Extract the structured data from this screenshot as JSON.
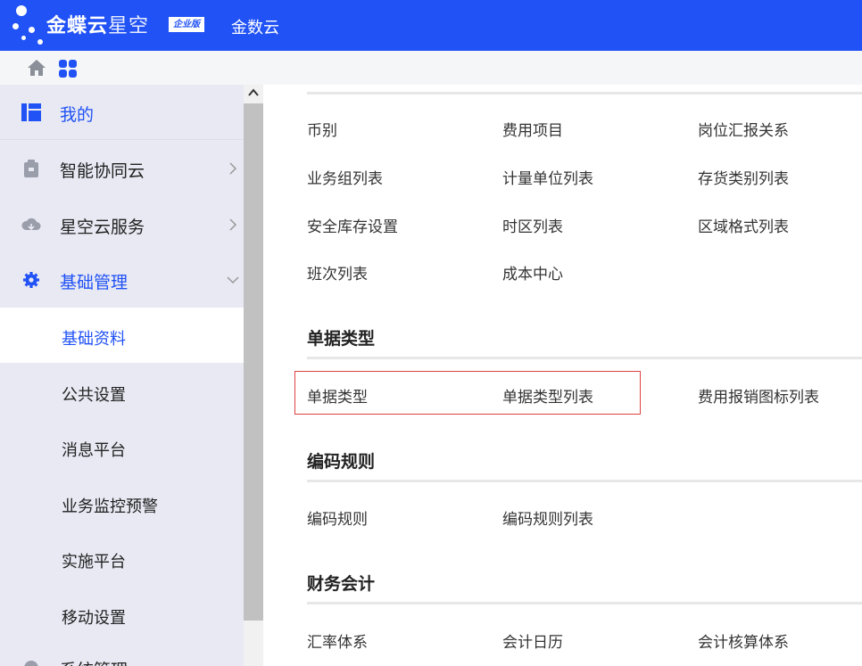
{
  "header": {
    "brand_main": "金蝶云",
    "brand_sub": "星空",
    "edition": "企业版",
    "cloud_name": "金数云"
  },
  "sidebar": {
    "groups": [
      {
        "label": "我的",
        "icon": "dashboard-icon"
      },
      {
        "label": "智能协同云",
        "icon": "clipboard-icon"
      },
      {
        "label": "星空云服务",
        "icon": "cloud-icon"
      },
      {
        "label": "基础管理",
        "icon": "gear-icon"
      }
    ],
    "subitems": [
      {
        "label": "基础资料",
        "active": true
      },
      {
        "label": "公共设置"
      },
      {
        "label": "消息平台"
      },
      {
        "label": "业务监控预警"
      },
      {
        "label": "实施平台"
      },
      {
        "label": "移动设置"
      },
      {
        "label": "系统管理"
      }
    ]
  },
  "content": {
    "top_items": [
      [
        "币别",
        "费用项目",
        "岗位汇报关系"
      ],
      [
        "业务组列表",
        "计量单位列表",
        "存货类别列表"
      ],
      [
        "安全库存设置",
        "时区列表",
        "区域格式列表"
      ],
      [
        "班次列表",
        "成本中心"
      ]
    ],
    "sections": [
      {
        "title": "单据类型",
        "items": [
          "单据类型",
          "单据类型列表",
          "费用报销图标列表"
        ]
      },
      {
        "title": "编码规则",
        "items": [
          "编码规则",
          "编码规则列表"
        ]
      },
      {
        "title": "财务会计",
        "items": [
          "汇率体系",
          "会计日历",
          "会计核算体系"
        ]
      }
    ]
  },
  "colors": {
    "accent": "#2152f5",
    "highlight_border": "#e04040"
  }
}
